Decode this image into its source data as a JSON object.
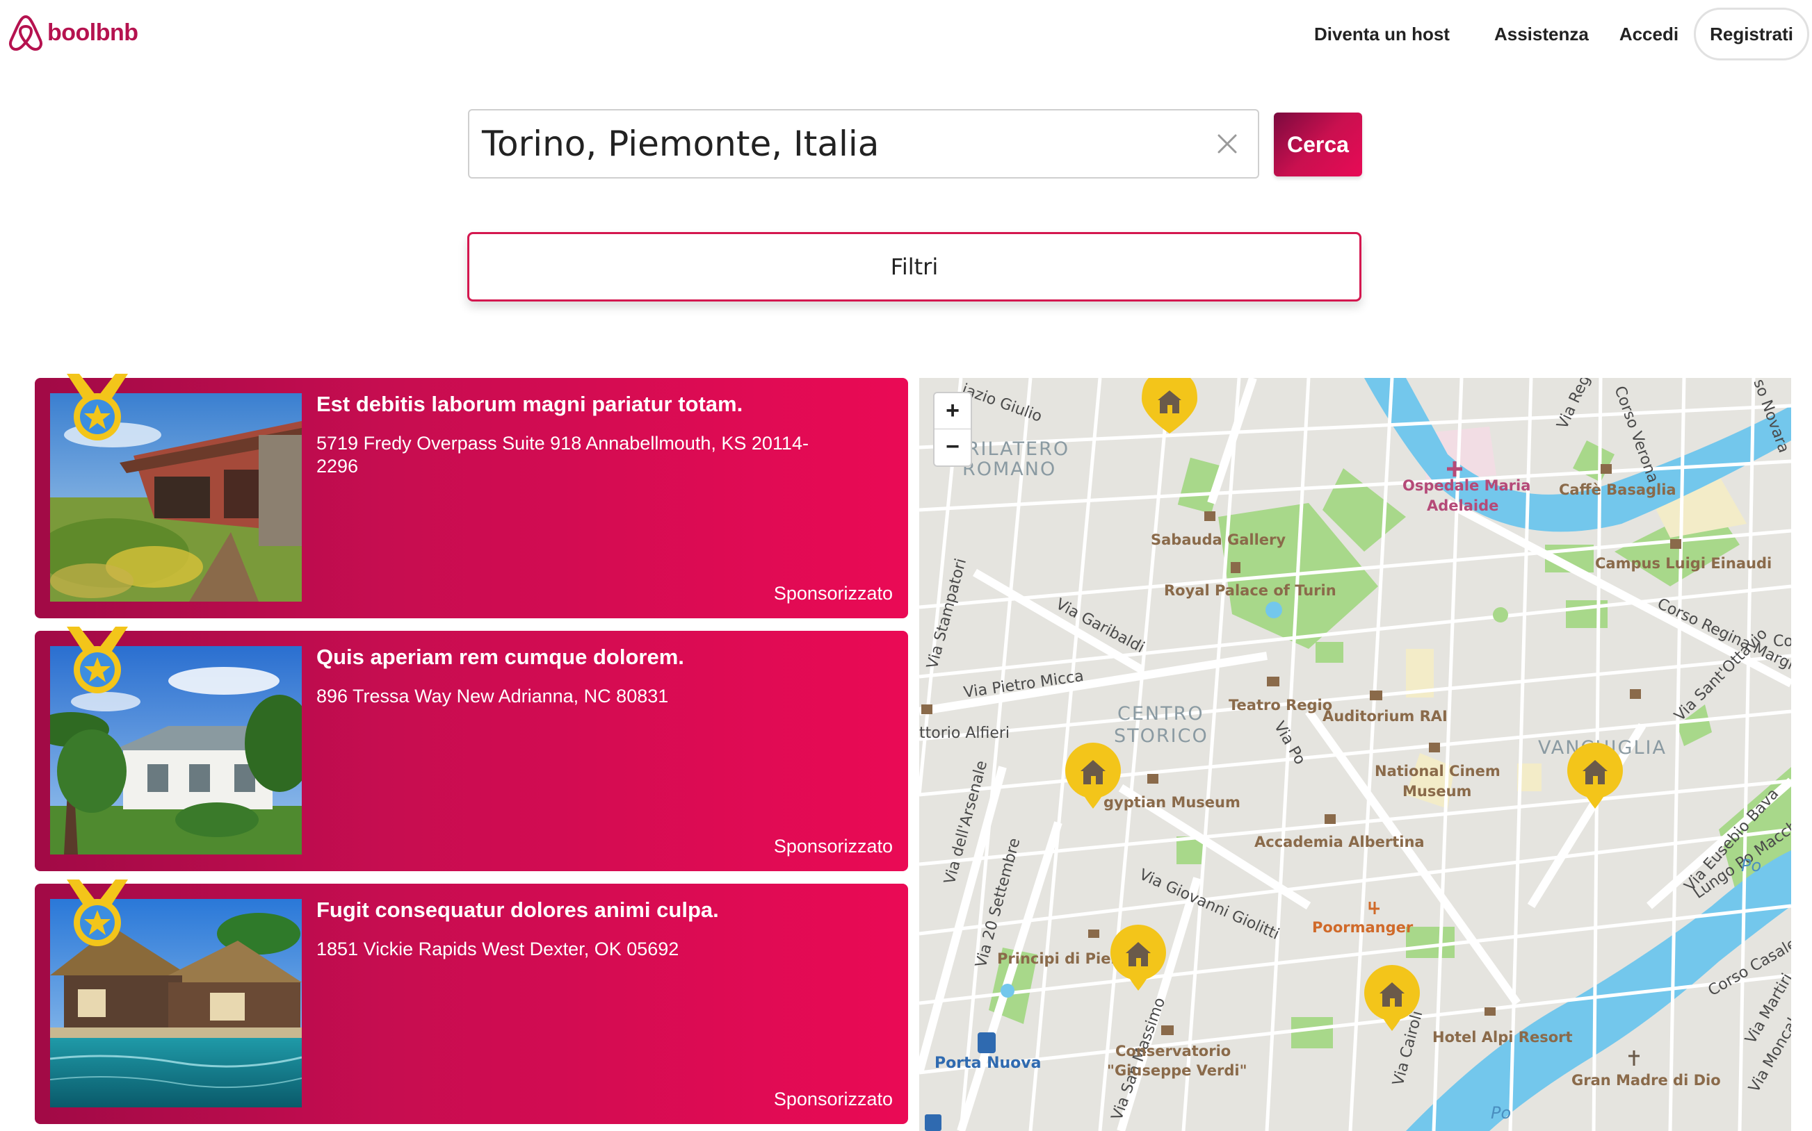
{
  "brand": {
    "name": "boolbnb",
    "color": "#b5124f"
  },
  "nav": {
    "become_host": "Diventa un host",
    "help": "Assistenza",
    "login": "Accedi",
    "register": "Registrati"
  },
  "search": {
    "value": "Torino, Piemonte, Italia",
    "button": "Cerca"
  },
  "filters": {
    "label": "Filtri"
  },
  "cards": [
    {
      "title": "Est debitis laborum magni pariatur totam.",
      "address": "5719 Fredy Overpass Suite 918 Annabellmouth, KS 20114-2296",
      "badge": "Sponsorizzato",
      "image": "red-villa-garden"
    },
    {
      "title": "Quis aperiam rem cumque dolorem.",
      "address": "896 Tressa Way New Adrianna, NC 80831",
      "badge": "Sponsorizzato",
      "image": "white-house-palms"
    },
    {
      "title": "Fugit consequatur dolores animi culpa.",
      "address": "1851 Vickie Rapids West Dexter, OK 05692",
      "badge": "Sponsorizzato",
      "image": "thatched-resort-pool"
    }
  ],
  "map": {
    "zoom_in": "+",
    "zoom_out": "−",
    "labels": {
      "quadrilatero1": "DRILATERO",
      "quadrilatero2": "ROMANO",
      "centro1": "CENTRO",
      "centro2": "STORICO",
      "vanchiglia": "VANCHIGLIA",
      "sabauda": "Sabauda Gallery",
      "royal": "Royal Palace of Turin",
      "teatro": "Teatro Regio",
      "rai": "Auditorium RAI",
      "cinema1": "National Cinem",
      "cinema2": "Museum",
      "egyptian": "gyptian Museum",
      "albertina": "Accademia Albertina",
      "poormanger": "Poormanger",
      "principi": "Principi di Piem",
      "conservatorio1": "Conservatorio",
      "conservatorio2": "\"Giuseppe Verdi\"",
      "alpi": "Hotel Alpi Resort",
      "granmadre": "Gran Madre di Dio",
      "portanuova": "Porta Nuova",
      "ospedale1": "Ospedale Maria",
      "ospedale2": "Adelaide",
      "caffe": "Caffè Basaglia",
      "campus": "Campus Luigi Einaudi",
      "via_garibaldi": "Via Garibaldi",
      "via_pietro_micca": "Via Pietro Micca",
      "via_po": "Via Po",
      "via_giolitti": "Via Giovanni Giolitti",
      "via_arsenale": "Via dell'Arsenale",
      "via_20_settembre": "Via 20 Settembre",
      "via_stampatori": "Via Stampatori",
      "via_san_massimo": "Via San Massimo",
      "via_santottavio": "Via Sant'Ottavio",
      "via_eusebio_bava": "Via Eusebio Bava",
      "corso_regina": "Corso Regina Margherita",
      "lungo_po": "Lungo Po Macchiavelli",
      "corso_casale": "Corso Casale",
      "via_martiri": "Via Martiri",
      "via_moncalvo": "Via Moncal",
      "via_regg": "Via Regg",
      "corso_verona": "Corso Verona",
      "so_novara": "so Novara",
      "co": "Co",
      "piazzo_giulio": "iazio Giulio",
      "torio_alfieri": "ttorio Alfieri",
      "po1": "Po",
      "po2": "Po",
      "cairoli": "Via Cairoli"
    }
  }
}
